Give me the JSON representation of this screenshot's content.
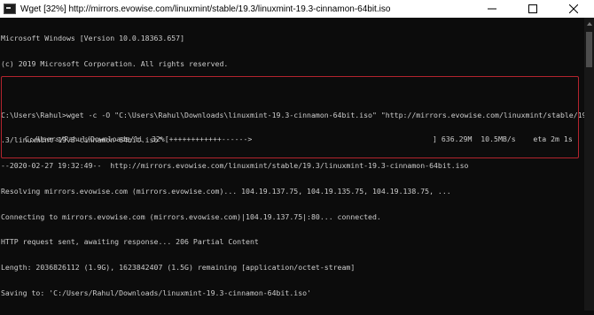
{
  "window": {
    "title": "Wget [32%] http://mirrors.evowise.com/linuxmint/stable/19.3/linuxmint-19.3-cinnamon-64bit.iso"
  },
  "console": {
    "lines": [
      "Microsoft Windows [Version 10.0.18363.657]",
      "(c) 2019 Microsoft Corporation. All rights reserved.",
      "",
      "C:\\Users\\Rahul>wget -c -O \"C:\\Users\\Rahul\\Downloads\\linuxmint-19.3-cinnamon-64bit.iso\" \"http://mirrors.evowise.com/linuxmint/stable/19",
      ".3/linuxmint-19.3-cinnamon-64bit.iso\"",
      "--2020-02-27 19:32:49--  http://mirrors.evowise.com/linuxmint/stable/19.3/linuxmint-19.3-cinnamon-64bit.iso",
      "Resolving mirrors.evowise.com (mirrors.evowise.com)... 104.19.137.75, 104.19.135.75, 104.19.138.75, ...",
      "Connecting to mirrors.evowise.com (mirrors.evowise.com)|104.19.137.75|:80... connected.",
      "HTTP request sent, awaiting response... 206 Partial Content",
      "Length: 2036826112 (1.9G), 1623842407 (1.5G) remaining [application/octet-stream]",
      "Saving to: 'C:/Users/Rahul/Downloads/linuxmint-19.3-cinnamon-64bit.iso'"
    ],
    "progress": {
      "file": "C:/Users/Rahul/Downloads/li",
      "percent_text": "32%",
      "bar": "[++++++++++++------>",
      "bar_end": "]",
      "size": "636.29M",
      "rate": "10.5MB/s",
      "eta": "eta 2m 1s",
      "fraction": 0.32
    }
  },
  "colors": {
    "highlight_border": "#b3242e",
    "console_bg": "#0c0c0c",
    "console_text": "#cccccc"
  },
  "icons": {
    "app": "cmd-icon",
    "minimize": "minimize-icon",
    "maximize": "maximize-icon",
    "close": "close-icon"
  }
}
